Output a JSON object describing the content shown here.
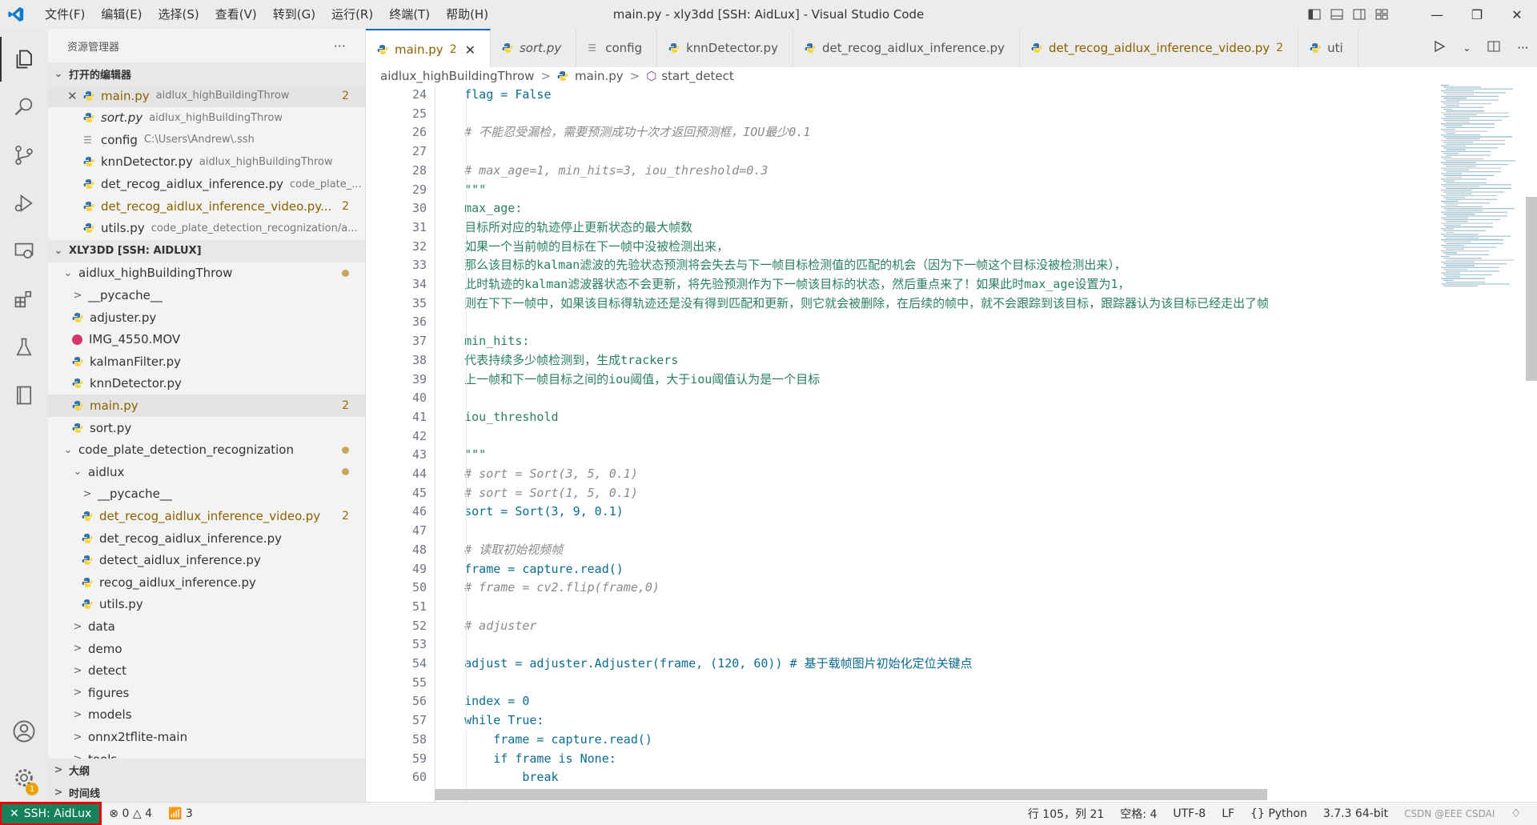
{
  "titlebar": {
    "menu": [
      "文件(F)",
      "编辑(E)",
      "选择(S)",
      "查看(V)",
      "转到(G)",
      "运行(R)",
      "终端(T)",
      "帮助(H)"
    ],
    "title": "main.py - xly3dd [SSH: AidLux] - Visual Studio Code"
  },
  "sidebar": {
    "title": "资源管理器",
    "more": "···",
    "open_editors_header": "打开的编辑器",
    "open_editors": [
      {
        "name": "main.py",
        "path": "aidlux_highBuildingThrow",
        "count": "2",
        "italic": false
      },
      {
        "name": "sort.py",
        "path": "aidlux_highBuildingThrow",
        "count": "",
        "italic": true
      },
      {
        "name": "config",
        "path": "C:\\Users\\Andrew\\.ssh",
        "count": "",
        "italic": false
      },
      {
        "name": "knnDetector.py",
        "path": "aidlux_highBuildingThrow",
        "count": "",
        "italic": false
      },
      {
        "name": "det_recog_aidlux_inference.py",
        "path": "code_plate_...",
        "count": "",
        "italic": false
      },
      {
        "name": "det_recog_aidlux_inference_video.py...",
        "path": "",
        "count": "2",
        "italic": false
      },
      {
        "name": "utils.py",
        "path": "code_plate_detection_recognization/a...",
        "count": "",
        "italic": false
      }
    ],
    "workspace_header": "XLY3DD [SSH: AIDLUX]",
    "tree": [
      {
        "label": "aidlux_highBuildingThrow",
        "depth": 1,
        "kind": "folder-open",
        "mark": "dot"
      },
      {
        "label": "__pycache__",
        "depth": 2,
        "kind": "folder",
        "mark": ""
      },
      {
        "label": "adjuster.py",
        "depth": 2,
        "kind": "py",
        "mark": ""
      },
      {
        "label": "IMG_4550.MOV",
        "depth": 2,
        "kind": "mov",
        "mark": ""
      },
      {
        "label": "kalmanFilter.py",
        "depth": 2,
        "kind": "py",
        "mark": ""
      },
      {
        "label": "knnDetector.py",
        "depth": 2,
        "kind": "py",
        "mark": ""
      },
      {
        "label": "main.py",
        "depth": 2,
        "kind": "py",
        "mark": "2"
      },
      {
        "label": "sort.py",
        "depth": 2,
        "kind": "py",
        "mark": ""
      },
      {
        "label": "code_plate_detection_recognization",
        "depth": 1,
        "kind": "folder-open",
        "mark": "dot"
      },
      {
        "label": "aidlux",
        "depth": 2,
        "kind": "folder-open",
        "mark": "dot"
      },
      {
        "label": "__pycache__",
        "depth": 3,
        "kind": "folder",
        "mark": ""
      },
      {
        "label": "det_recog_aidlux_inference_video.py",
        "depth": 3,
        "kind": "py",
        "mark": "2"
      },
      {
        "label": "det_recog_aidlux_inference.py",
        "depth": 3,
        "kind": "py",
        "mark": ""
      },
      {
        "label": "detect_aidlux_inference.py",
        "depth": 3,
        "kind": "py",
        "mark": ""
      },
      {
        "label": "recog_aidlux_inference.py",
        "depth": 3,
        "kind": "py",
        "mark": ""
      },
      {
        "label": "utils.py",
        "depth": 3,
        "kind": "py",
        "mark": ""
      },
      {
        "label": "data",
        "depth": 2,
        "kind": "folder",
        "mark": ""
      },
      {
        "label": "demo",
        "depth": 2,
        "kind": "folder",
        "mark": ""
      },
      {
        "label": "detect",
        "depth": 2,
        "kind": "folder",
        "mark": ""
      },
      {
        "label": "figures",
        "depth": 2,
        "kind": "folder",
        "mark": ""
      },
      {
        "label": "models",
        "depth": 2,
        "kind": "folder",
        "mark": ""
      },
      {
        "label": "onnx2tflite-main",
        "depth": 2,
        "kind": "folder",
        "mark": ""
      },
      {
        "label": "tools",
        "depth": 2,
        "kind": "folder",
        "mark": ""
      }
    ],
    "outline_header": "大纲",
    "timeline_header": "时间线"
  },
  "tabs": [
    {
      "label": "main.py",
      "count": "2",
      "active": true,
      "italic": false
    },
    {
      "label": "sort.py",
      "count": "",
      "active": false,
      "italic": true
    },
    {
      "label": "config",
      "count": "",
      "active": false,
      "italic": false
    },
    {
      "label": "knnDetector.py",
      "count": "",
      "active": false,
      "italic": false
    },
    {
      "label": "det_recog_aidlux_inference.py",
      "count": "",
      "active": false,
      "italic": false
    },
    {
      "label": "det_recog_aidlux_inference_video.py",
      "count": "2",
      "active": false,
      "italic": false
    },
    {
      "label": "uti",
      "count": "",
      "active": false,
      "italic": false
    }
  ],
  "breadcrumb": {
    "folder": "aidlux_highBuildingThrow",
    "file": "main.py",
    "symbol": "start_detect"
  },
  "editor": {
    "first_line": 24,
    "lines": [
      {
        "t": "    flag = False",
        "k": "code"
      },
      {
        "t": "",
        "k": "code"
      },
      {
        "t": "    # 不能忍受漏检，需要预测成功十次才返回预测框，IOU最少0.1",
        "k": "com"
      },
      {
        "t": "",
        "k": "code"
      },
      {
        "t": "    # max_age=1, min_hits=3, iou_threshold=0.3",
        "k": "com"
      },
      {
        "t": "    \"\"\"",
        "k": "str"
      },
      {
        "t": "    max_age:",
        "k": "str"
      },
      {
        "t": "    目标所对应的轨迹停止更新状态的最大帧数",
        "k": "str"
      },
      {
        "t": "    如果一个当前帧的目标在下一帧中没被检测出来，",
        "k": "str"
      },
      {
        "t": "    那么该目标的kalman滤波的先验状态预测将会失去与下一帧目标检测值的匹配的机会（因为下一帧这个目标没被检测出来），",
        "k": "str"
      },
      {
        "t": "    此时轨迹的kalman滤波器状态不会更新，将先验预测作为下一帧该目标的状态，然后重点来了！如果此时max_age设置为1，",
        "k": "str"
      },
      {
        "t": "    则在下下一帧中，如果该目标得轨迹还是没有得到匹配和更新，则它就会被删除，在后续的帧中，就不会跟踪到该目标，跟踪器认为该目标已经走出了帧",
        "k": "str"
      },
      {
        "t": "",
        "k": "code"
      },
      {
        "t": "    min_hits:",
        "k": "str"
      },
      {
        "t": "    代表持续多少帧检测到，生成trackers",
        "k": "str"
      },
      {
        "t": "    上一帧和下一帧目标之间的iou阈值，大于iou阈值认为是一个目标",
        "k": "str"
      },
      {
        "t": "",
        "k": "code"
      },
      {
        "t": "    iou_threshold",
        "k": "str"
      },
      {
        "t": "",
        "k": "code"
      },
      {
        "t": "    \"\"\"",
        "k": "str"
      },
      {
        "t": "    # sort = Sort(3, 5, 0.1)",
        "k": "com"
      },
      {
        "t": "    # sort = Sort(1, 5, 0.1)",
        "k": "com"
      },
      {
        "t": "    sort = Sort(3, 9, 0.1)",
        "k": "code"
      },
      {
        "t": "",
        "k": "code"
      },
      {
        "t": "    # 读取初始视频帧",
        "k": "com"
      },
      {
        "t": "    frame = capture.read()",
        "k": "code"
      },
      {
        "t": "    # frame = cv2.flip(frame,0)",
        "k": "com"
      },
      {
        "t": "",
        "k": "code"
      },
      {
        "t": "    # adjuster",
        "k": "com"
      },
      {
        "t": "",
        "k": "code"
      },
      {
        "t": "    adjust = adjuster.Adjuster(frame, (120, 60)) # 基于载帧图片初始化定位关键点",
        "k": "code"
      },
      {
        "t": "",
        "k": "code"
      },
      {
        "t": "    index = 0",
        "k": "code"
      },
      {
        "t": "    while True:",
        "k": "code"
      },
      {
        "t": "        frame = capture.read()",
        "k": "code"
      },
      {
        "t": "        if frame is None:",
        "k": "code"
      },
      {
        "t": "            break",
        "k": "code"
      }
    ]
  },
  "status": {
    "remote": "SSH: AidLux",
    "errors": "0",
    "warnings": "4",
    "ports": "3",
    "position": "行 105，列 21",
    "spaces": "空格: 4",
    "encoding": "UTF-8",
    "eol": "LF",
    "language": "Python",
    "interpreter": "3.7.3 64-bit",
    "watermark": "CSDN @EEE CSDAI"
  },
  "colors": {
    "accent": "#0a66c2",
    "remote_bg": "#16825d",
    "highlight_box": "#e00000"
  },
  "settings_badge": "1"
}
